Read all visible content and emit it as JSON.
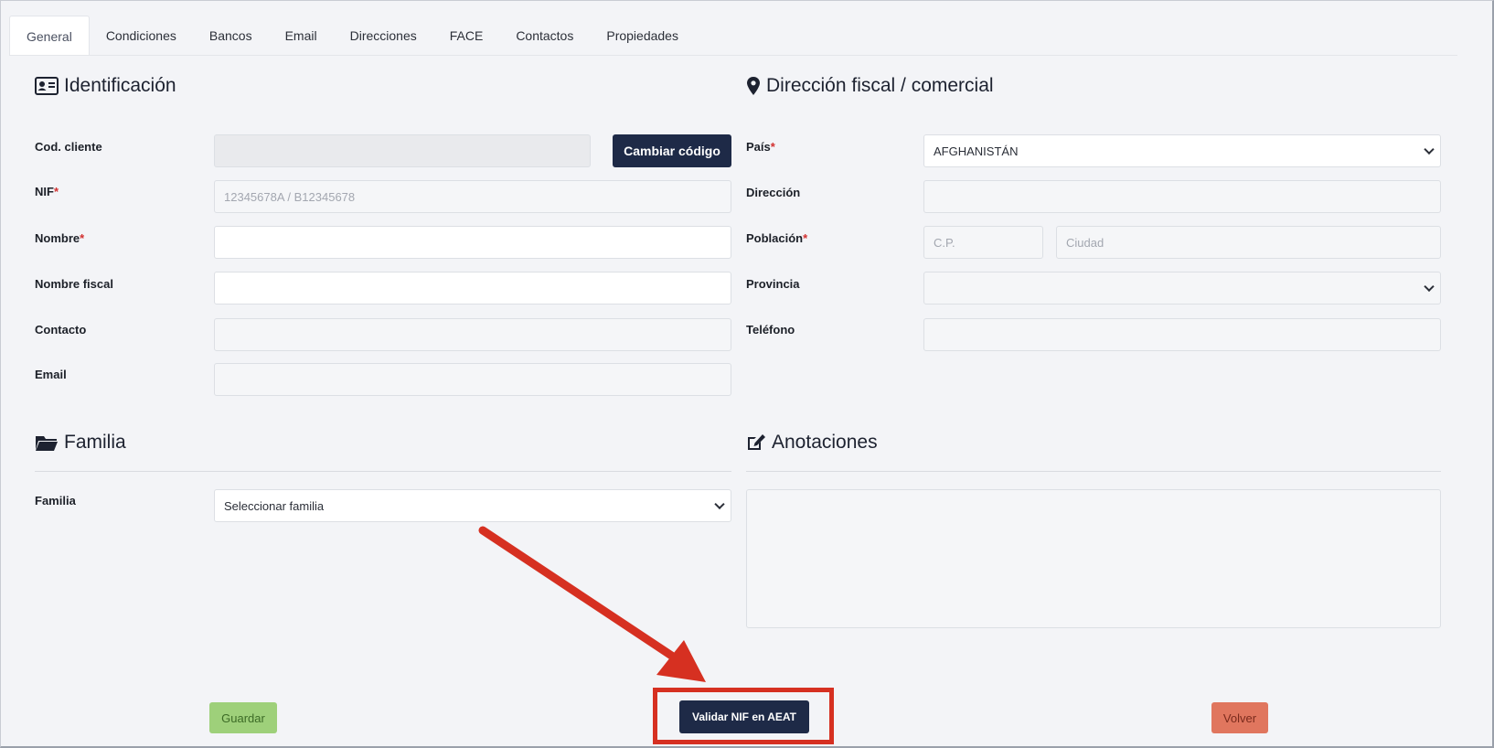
{
  "tabs": [
    "General",
    "Condiciones",
    "Bancos",
    "Email",
    "Direcciones",
    "FACE",
    "Contactos",
    "Propiedades"
  ],
  "identificacion": {
    "title": "Identificación",
    "cod_cliente_label": "Cod. cliente",
    "cambiar_codigo_label": "Cambiar código",
    "nif_label": "NIF",
    "nif_placeholder": "12345678A / B12345678",
    "nombre_label": "Nombre",
    "nombre_fiscal_label": "Nombre fiscal",
    "contacto_label": "Contacto",
    "email_label": "Email"
  },
  "direccion": {
    "title": "Dirección fiscal / comercial",
    "pais_label": "País",
    "pais_value": "AFGHANISTÁN",
    "direccion_label": "Dirección",
    "poblacion_label": "Población",
    "cp_placeholder": "C.P.",
    "ciudad_placeholder": "Ciudad",
    "provincia_label": "Provincia",
    "telefono_label": "Teléfono"
  },
  "familia": {
    "title": "Familia",
    "familia_label": "Familia",
    "familia_value": "Seleccionar familia"
  },
  "anotaciones": {
    "title": "Anotaciones"
  },
  "actions": {
    "guardar_label": "Guardar",
    "validar_label": "Validar NIF en AEAT",
    "volver_label": "Volver"
  },
  "required_mark": "*",
  "colors": {
    "primary_dark": "#1e2a47",
    "save_green": "#9ed07a",
    "back_red": "#e0765e",
    "highlight_red": "#d63021"
  }
}
